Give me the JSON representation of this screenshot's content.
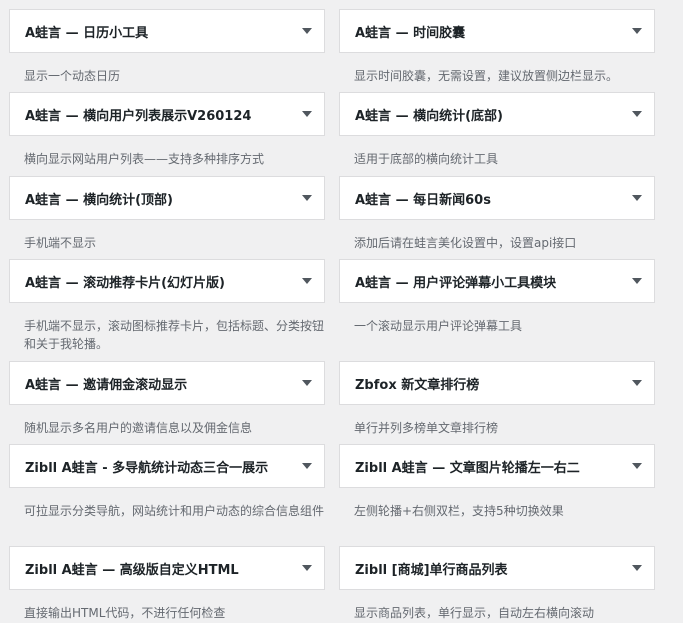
{
  "widgets": [
    {
      "title": "A蛙言 — 日历小工具",
      "description": "显示一个动态日历"
    },
    {
      "title": "A蛙言 — 时间胶囊",
      "description": "显示时间胶囊，无需设置，建议放置侧边栏显示。"
    },
    {
      "title": "A蛙言 — 横向用户列表展示V260124",
      "description": "横向显示网站用户列表——支持多种排序方式"
    },
    {
      "title": "A蛙言 — 横向统计(底部)",
      "description": "适用于底部的横向统计工具"
    },
    {
      "title": "A蛙言 — 横向统计(顶部)",
      "description": "手机端不显示"
    },
    {
      "title": "A蛙言 — 每日新闻60s",
      "description": "添加后请在蛙言美化设置中，设置api接口"
    },
    {
      "title": "A蛙言 — 滚动推荐卡片(幻灯片版)",
      "description": "手机端不显示，滚动图标推荐卡片，包括标题、分类按钮和关于我轮播。"
    },
    {
      "title": "A蛙言 — 用户评论弹幕小工具模块",
      "description": "一个滚动显示用户评论弹幕工具"
    },
    {
      "title": "A蛙言 — 邀请佣金滚动显示",
      "description": "随机显示多名用户的邀请信息以及佣金信息"
    },
    {
      "title": "Zbfox 新文章排行榜",
      "description": "单行并列多榜单文章排行榜"
    },
    {
      "title": "Zibll A蛙言 - 多导航统计动态三合一展示",
      "description": "可拉显示分类导航，网站统计和用户动态的综合信息组件"
    },
    {
      "title": "Zibll A蛙言 — 文章图片轮播左一右二",
      "description": "左侧轮播+右侧双栏，支持5种切换效果"
    },
    {
      "title": "Zibll A蛙言 — 高级版自定义HTML",
      "description": "直接输出HTML代码，不进行任何检查"
    },
    {
      "title": "Zibll [商城]单行商品列表",
      "description": "显示商品列表，单行显示，自动左右横向滚动"
    }
  ],
  "icons": {
    "toggle": "caret-down-icon"
  },
  "colors": {
    "background": "#f0f0f1",
    "card": "#ffffff",
    "border": "#dcdcde",
    "title": "#1d2327",
    "description": "#646970",
    "caret": "#50575e"
  }
}
